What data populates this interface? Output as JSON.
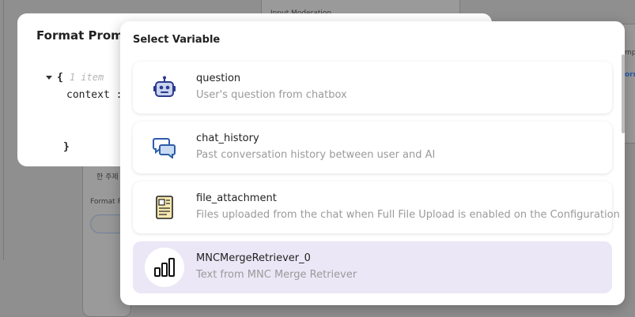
{
  "background": {
    "top_label": "Input Moderation",
    "korean_text": "한 주제",
    "node_label": "Format Pr",
    "right_text_1": "mpt",
    "right_text_2": "orm"
  },
  "format_dialog": {
    "title": "Format Prompt",
    "json": {
      "open_brace": "{",
      "items_count": "1 item",
      "key": "context",
      "colon": ":",
      "close_brace": "}"
    }
  },
  "select_variable": {
    "title": "Select Variable",
    "items": [
      {
        "name": "question",
        "description": "User's question from chatbox",
        "icon": "robot-icon",
        "selected": false
      },
      {
        "name": "chat_history",
        "description": "Past conversation history between user and AI",
        "icon": "chat-bubbles-icon",
        "selected": false
      },
      {
        "name": "file_attachment",
        "description": "Files uploaded from the chat when Full File Upload is enabled on the Configuration",
        "icon": "file-document-icon",
        "selected": false
      },
      {
        "name": "MNCMergeRetriever_0",
        "description": "Text from MNC Merge Retriever",
        "icon": "bar-chart-icon",
        "selected": true
      }
    ]
  },
  "colors": {
    "selected_bg": "#ece7f6",
    "robot_blue": "#2b3a8f",
    "chat_blue": "#2d5da8"
  }
}
